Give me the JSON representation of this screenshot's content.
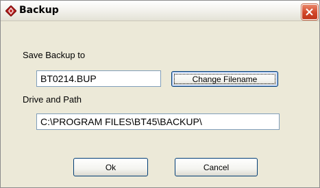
{
  "window": {
    "title": "Backup"
  },
  "form": {
    "save_label": "Save Backup to",
    "filename_value": "BT0214.BUP",
    "change_filename_button": "Change Filename",
    "path_label": "Drive and Path",
    "path_value": "C:\\PROGRAM FILES\\BT45\\BACKUP\\"
  },
  "buttons": {
    "ok": "Ok",
    "cancel": "Cancel"
  },
  "icons": {
    "app": "diamond-arrow-icon",
    "close": "close-icon"
  },
  "colors": {
    "close_button": "#d2462a",
    "field_border": "#7f9db9",
    "button_border": "#003c74",
    "dialog_bg": "#ece9d8"
  }
}
